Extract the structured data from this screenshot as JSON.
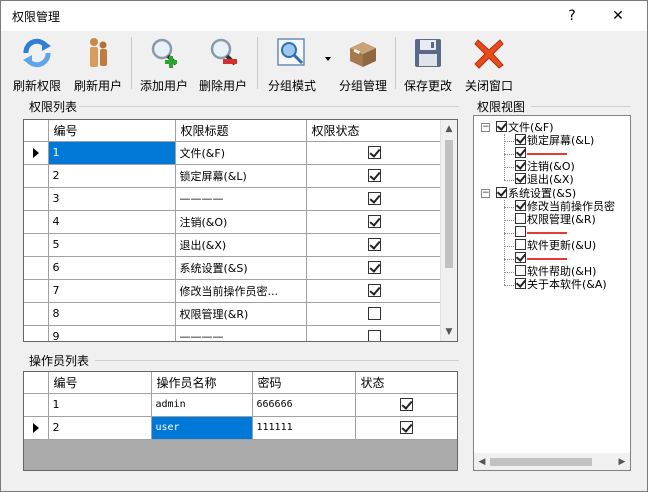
{
  "window": {
    "title": "权限管理",
    "help_glyph": "?",
    "close_glyph": "✕"
  },
  "toolbar": {
    "buttons": [
      {
        "label": "刷新权限",
        "icon": "refresh-permissions-icon"
      },
      {
        "label": "刷新用户",
        "icon": "refresh-users-icon"
      },
      {
        "label": "添加用户",
        "icon": "add-user-icon"
      },
      {
        "label": "删除用户",
        "icon": "delete-user-icon"
      },
      {
        "label": "分组模式",
        "icon": "group-mode-icon"
      },
      {
        "label": "分组管理",
        "icon": "group-manage-icon"
      },
      {
        "label": "保存更改",
        "icon": "save-icon"
      },
      {
        "label": "关闭窗口",
        "icon": "close-window-icon"
      }
    ]
  },
  "permissions": {
    "group_title": "权限列表",
    "columns": [
      "编号",
      "权限标题",
      "权限状态"
    ],
    "rows": [
      {
        "id": "1",
        "title": "文件(&F)",
        "checked": true
      },
      {
        "id": "2",
        "title": "锁定屏幕(&L)",
        "checked": true
      },
      {
        "id": "3",
        "title": "————",
        "checked": true
      },
      {
        "id": "4",
        "title": "注销(&O)",
        "checked": true
      },
      {
        "id": "5",
        "title": "退出(&X)",
        "checked": true
      },
      {
        "id": "6",
        "title": "系统设置(&S)",
        "checked": true
      },
      {
        "id": "7",
        "title": "修改当前操作员密...",
        "checked": true
      },
      {
        "id": "8",
        "title": "权限管理(&R)",
        "checked": false
      },
      {
        "id": "9",
        "title": "————",
        "checked": false
      }
    ]
  },
  "operators": {
    "group_title": "操作员列表",
    "columns": [
      "编号",
      "操作员名称",
      "密码",
      "状态"
    ],
    "rows": [
      {
        "id": "1",
        "name": "admin",
        "password": "666666",
        "checked": true
      },
      {
        "id": "2",
        "name": "user",
        "password": "111111",
        "checked": true
      }
    ]
  },
  "tree": {
    "group_title": "权限视图",
    "nodes": [
      {
        "label": "文件(&F)",
        "level": 0,
        "checked": true,
        "expander": "−"
      },
      {
        "label": "锁定屏幕(&L)",
        "level": 1,
        "checked": true
      },
      {
        "label": "",
        "level": 1,
        "checked": true,
        "separator": true
      },
      {
        "label": "注销(&O)",
        "level": 1,
        "checked": true
      },
      {
        "label": "退出(&X)",
        "level": 1,
        "checked": true
      },
      {
        "label": "系统设置(&S)",
        "level": 0,
        "checked": true,
        "expander": "−"
      },
      {
        "label": "修改当前操作员密",
        "level": 1,
        "checked": true
      },
      {
        "label": "权限管理(&R)",
        "level": 1,
        "checked": false
      },
      {
        "label": "",
        "level": 1,
        "checked": false,
        "separator": true
      },
      {
        "label": "软件更新(&U)",
        "level": 1,
        "checked": false
      },
      {
        "label": "",
        "level": 1,
        "checked": true,
        "separator": true
      },
      {
        "label": "软件帮助(&H)",
        "level": 1,
        "checked": false
      },
      {
        "label": "关于本软件(&A)",
        "level": 1,
        "checked": true
      }
    ]
  },
  "colors": {
    "selection": "#0078d7",
    "separator_red": "#e53935"
  }
}
